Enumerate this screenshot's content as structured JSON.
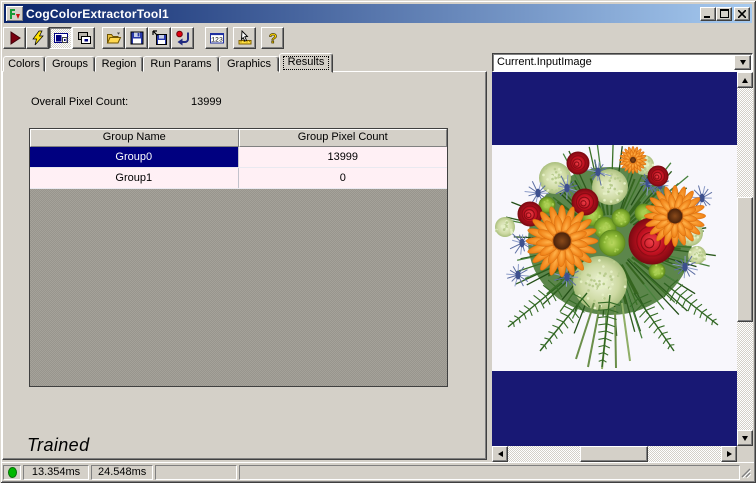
{
  "window": {
    "title": "CogColorExtractorTool1"
  },
  "titlebar": {
    "buttons": [
      "minimize",
      "maximize",
      "close"
    ]
  },
  "toolbar": {
    "buttons": [
      "run",
      "electric-run",
      "show-image-record",
      "show-last-run-record",
      "open-file",
      "save",
      "save-subset",
      "reset",
      "numeric-results",
      "electrode",
      "help"
    ],
    "numeric_glyph": "123",
    "help_glyph": "?"
  },
  "tabs": {
    "items": [
      "Colors",
      "Groups",
      "Region",
      "Run Params",
      "Graphics",
      "Results"
    ],
    "selected": "Results"
  },
  "results": {
    "overall_label": "Overall Pixel Count:",
    "overall_value": "13999",
    "headers": [
      "Group Name",
      "Group Pixel Count"
    ],
    "rows": [
      [
        "Group0",
        "13999"
      ],
      [
        "Group1",
        "0"
      ]
    ],
    "selected_row": "Group0",
    "trained_label": "Trained"
  },
  "image_panel": {
    "selected_image": "Current.InputImage"
  },
  "statusbar": {
    "panels": [
      "13.354ms",
      "24.548ms",
      "",
      ""
    ]
  },
  "colors": {
    "selection": "#000080",
    "titlebar_left": "#0a246a",
    "titlebar_right": "#a6caf0",
    "view_background": "#181874",
    "cell_background": "#fff0f5",
    "status_dot": "#00b800"
  }
}
